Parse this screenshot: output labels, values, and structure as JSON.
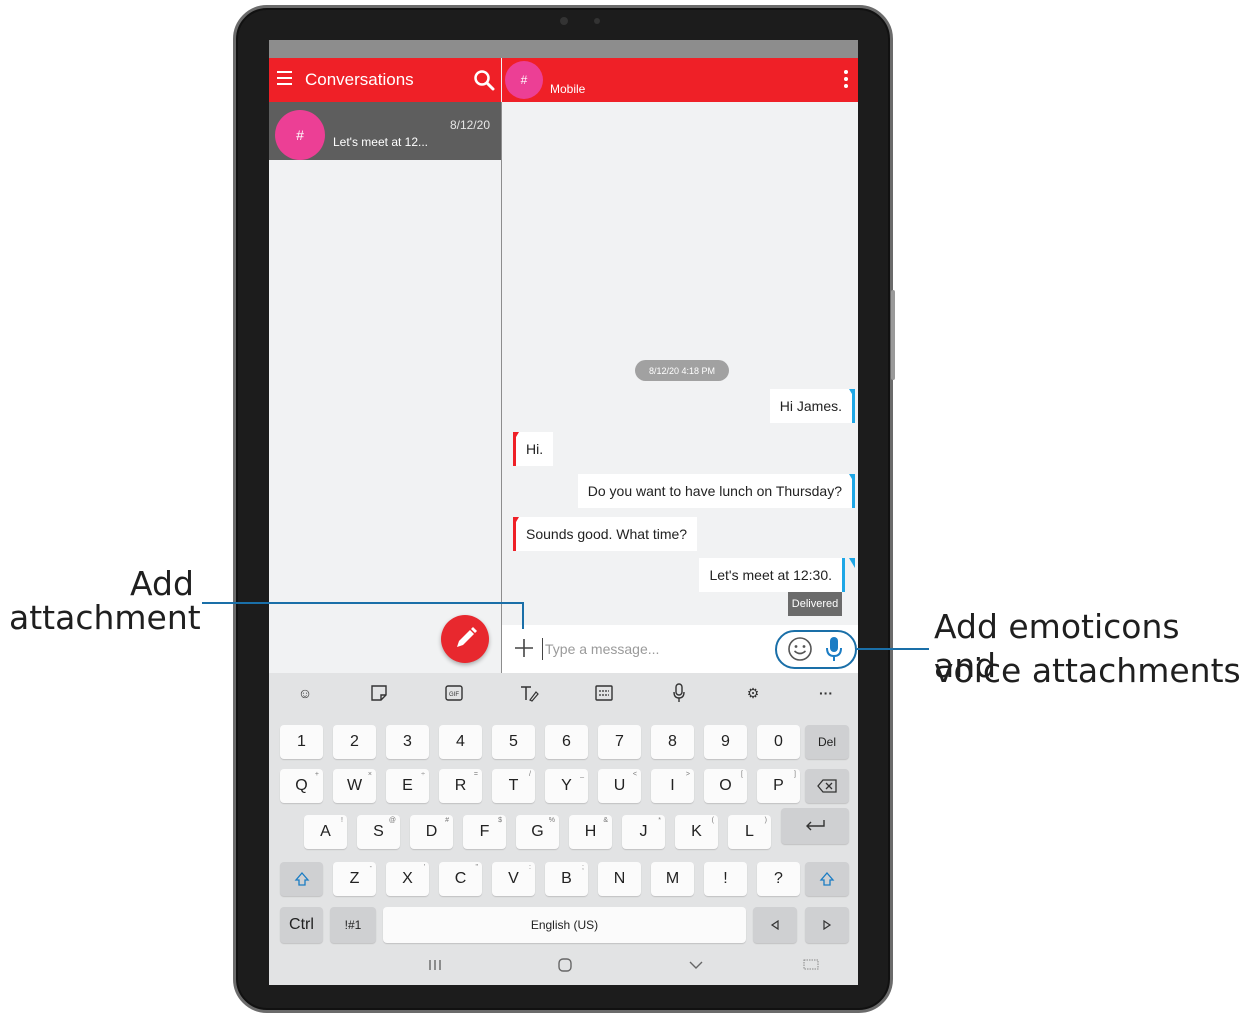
{
  "left_panel": {
    "title": "Conversations",
    "conversations": [
      {
        "avatar": "#",
        "preview": "Let's meet at 12...",
        "date": "8/12/20"
      }
    ]
  },
  "chat": {
    "avatar": "#",
    "title": "Mobile",
    "date_chip": "8/12/20 4:18 PM",
    "messages": [
      {
        "direction": "out",
        "text": "Hi James."
      },
      {
        "direction": "in",
        "text": "Hi."
      },
      {
        "direction": "out",
        "text": "Do you want to have lunch on Thursday?"
      },
      {
        "direction": "in",
        "text": "Sounds good. What time?"
      },
      {
        "direction": "out",
        "text": "Let's meet at 12:30."
      }
    ],
    "status": "Delivered",
    "input_placeholder": "Type a message..."
  },
  "keyboard": {
    "number_row": [
      "1",
      "2",
      "3",
      "4",
      "5",
      "6",
      "7",
      "8",
      "9",
      "0"
    ],
    "del_label": "Del",
    "row_q": [
      "Q",
      "W",
      "E",
      "R",
      "T",
      "Y",
      "U",
      "I",
      "O",
      "P"
    ],
    "row_q_sub": [
      "+",
      "×",
      "÷",
      "=",
      "/",
      "_",
      "<",
      ">",
      "[",
      "]"
    ],
    "row_a": [
      "A",
      "S",
      "D",
      "F",
      "G",
      "H",
      "J",
      "K",
      "L"
    ],
    "row_a_sub": [
      "!",
      "@",
      "#",
      "$",
      "%",
      "&",
      "*",
      "(",
      ")"
    ],
    "row_z": [
      "Z",
      "X",
      "C",
      "V",
      "B",
      "N",
      "M",
      "!",
      "?"
    ],
    "row_z_sub": [
      "-",
      "'",
      "\"",
      ":",
      ";",
      "",
      "",
      "",
      ""
    ],
    "ctrl_label": "Ctrl",
    "symbols_label": "!#1",
    "space_label": "English (US)"
  },
  "annotations": {
    "attachment_line1": "Add",
    "attachment_line2": "attachment",
    "emoticons_line1": "Add emoticons and",
    "emoticons_line2": "voice attachments"
  },
  "icons": {
    "menu": "hamburger-menu-icon",
    "search": "search-icon",
    "more": "more-vert-icon",
    "compose": "pencil-icon",
    "attach": "plus-icon",
    "emoji": "smiley-icon",
    "mic": "microphone-icon"
  },
  "colors": {
    "header_red": "#ef2027",
    "avatar_pink": "#ec3f95",
    "outgoing_accent": "#1ea7e6",
    "annotation_blue": "#1a6fa8"
  }
}
